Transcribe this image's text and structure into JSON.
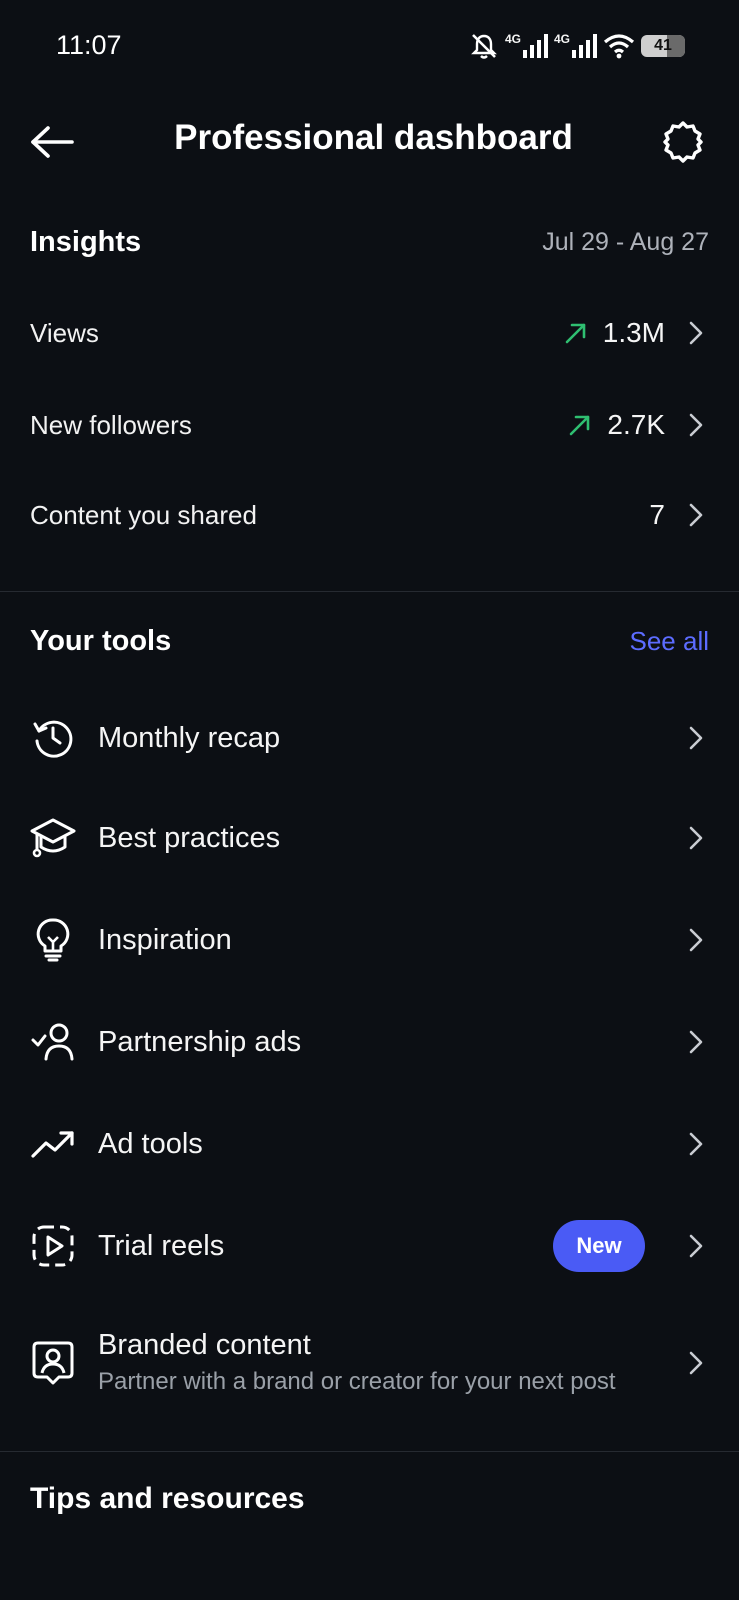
{
  "status_bar": {
    "time": "11:07",
    "network_1": "4G",
    "network_2": "4G",
    "battery": "41"
  },
  "header": {
    "title": "Professional dashboard",
    "back_icon": "arrow-left-icon",
    "settings_icon": "gear-icon"
  },
  "insights": {
    "title": "Insights",
    "date_range": "Jul 29 - Aug 27",
    "metrics": [
      {
        "label": "Views",
        "value": "1.3M",
        "trend": "up"
      },
      {
        "label": "New followers",
        "value": "2.7K",
        "trend": "up"
      },
      {
        "label": "Content you shared",
        "value": "7",
        "trend": ""
      }
    ]
  },
  "tools": {
    "title": "Your tools",
    "see_all": "See all",
    "items": [
      {
        "label": "Monthly recap",
        "icon": "history-clock-icon"
      },
      {
        "label": "Best practices",
        "icon": "graduation-cap-icon"
      },
      {
        "label": "Inspiration",
        "icon": "lightbulb-icon"
      },
      {
        "label": "Partnership ads",
        "icon": "person-check-icon"
      },
      {
        "label": "Ad tools",
        "icon": "trending-up-icon"
      },
      {
        "label": "Trial reels",
        "icon": "reel-play-icon",
        "badge": "New"
      },
      {
        "label": "Branded content",
        "icon": "branded-person-icon",
        "subtitle": "Partner with a brand or creator for your next post"
      }
    ]
  },
  "tips": {
    "title": "Tips and resources"
  },
  "colors": {
    "background": "#0c0f14",
    "accent": "#4a5bf5",
    "link": "#5c6cff",
    "trend_up": "#2fbf71",
    "muted": "#9aa0a8"
  }
}
